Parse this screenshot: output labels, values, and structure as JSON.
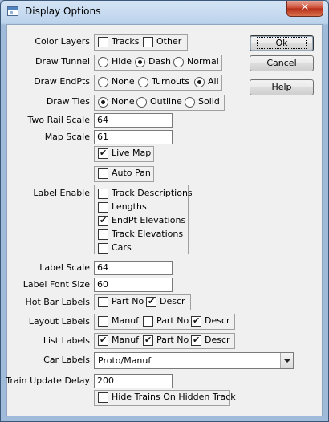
{
  "window": {
    "title": "Display Options",
    "close_glyph": "✕"
  },
  "buttons": {
    "ok": "Ok",
    "cancel": "Cancel",
    "help": "Help"
  },
  "color_layers": {
    "label": "Color Layers",
    "tracks": "Tracks",
    "other": "Other",
    "tracks_checked": false,
    "other_checked": false
  },
  "draw_tunnel": {
    "label": "Draw Tunnel",
    "options": [
      "Hide",
      "Dash",
      "Normal"
    ],
    "selected": "Dash"
  },
  "draw_endpts": {
    "label": "Draw EndPts",
    "options": [
      "None",
      "Turnouts",
      "All"
    ],
    "selected": "All"
  },
  "draw_ties": {
    "label": "Draw Ties",
    "options": [
      "None",
      "Outline",
      "Solid"
    ],
    "selected": "None"
  },
  "two_rail_scale": {
    "label": "Two Rail Scale",
    "value": "64"
  },
  "map_scale": {
    "label": "Map Scale",
    "value": "61"
  },
  "live_map": {
    "label": "Live Map",
    "checked": true
  },
  "auto_pan": {
    "label": "Auto Pan",
    "checked": false
  },
  "label_enable": {
    "label": "Label Enable",
    "items": [
      {
        "label": "Track Descriptions",
        "checked": false
      },
      {
        "label": "Lengths",
        "checked": false
      },
      {
        "label": "EndPt Elevations",
        "checked": true
      },
      {
        "label": "Track Elevations",
        "checked": false
      },
      {
        "label": "Cars",
        "checked": false
      }
    ]
  },
  "label_scale": {
    "label": "Label Scale",
    "value": "64"
  },
  "label_font_size": {
    "label": "Label Font Size",
    "value": "60"
  },
  "hot_bar_labels": {
    "label": "Hot Bar Labels",
    "part_no": "Part No",
    "descr": "Descr",
    "part_no_checked": false,
    "descr_checked": true
  },
  "layout_labels": {
    "label": "Layout Labels",
    "manuf": "Manuf",
    "part_no": "Part No",
    "descr": "Descr",
    "manuf_checked": false,
    "part_no_checked": false,
    "descr_checked": true
  },
  "list_labels": {
    "label": "List Labels",
    "manuf": "Manuf",
    "part_no": "Part No",
    "descr": "Descr",
    "manuf_checked": true,
    "part_no_checked": true,
    "descr_checked": true
  },
  "car_labels": {
    "label": "Car Labels",
    "value": "Proto/Manuf"
  },
  "train_update_delay": {
    "label": "Train Update Delay",
    "value": "200"
  },
  "hide_trains": {
    "label": "Hide Trains On Hidden Track",
    "checked": false
  }
}
